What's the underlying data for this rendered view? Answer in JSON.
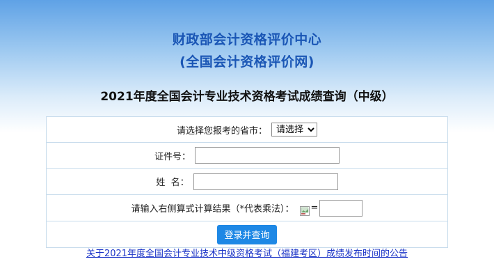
{
  "header": {
    "org_line1": "财政部会计资格评价中心",
    "org_line2": "(全国会计资格评价网)",
    "exam_title": "2021年度全国会计专业技术资格考试成绩查询（中级）"
  },
  "form": {
    "province_label": "请选择您报考的省市：",
    "province_selected": "请选择",
    "cert_label": "证件号：",
    "cert_value": "",
    "name_label": "姓  名：",
    "name_value": "",
    "captcha_label": "请输入右侧算式计算结果（*代表乘法）：",
    "captcha_icon": "broken-image-icon",
    "captcha_eq": "=",
    "captcha_value": "",
    "submit_label": "登录并查询"
  },
  "notice": {
    "link_text": "关于2021年度全国会计专业技术中级资格考试（福建考区）成绩发布时间的公告"
  }
}
